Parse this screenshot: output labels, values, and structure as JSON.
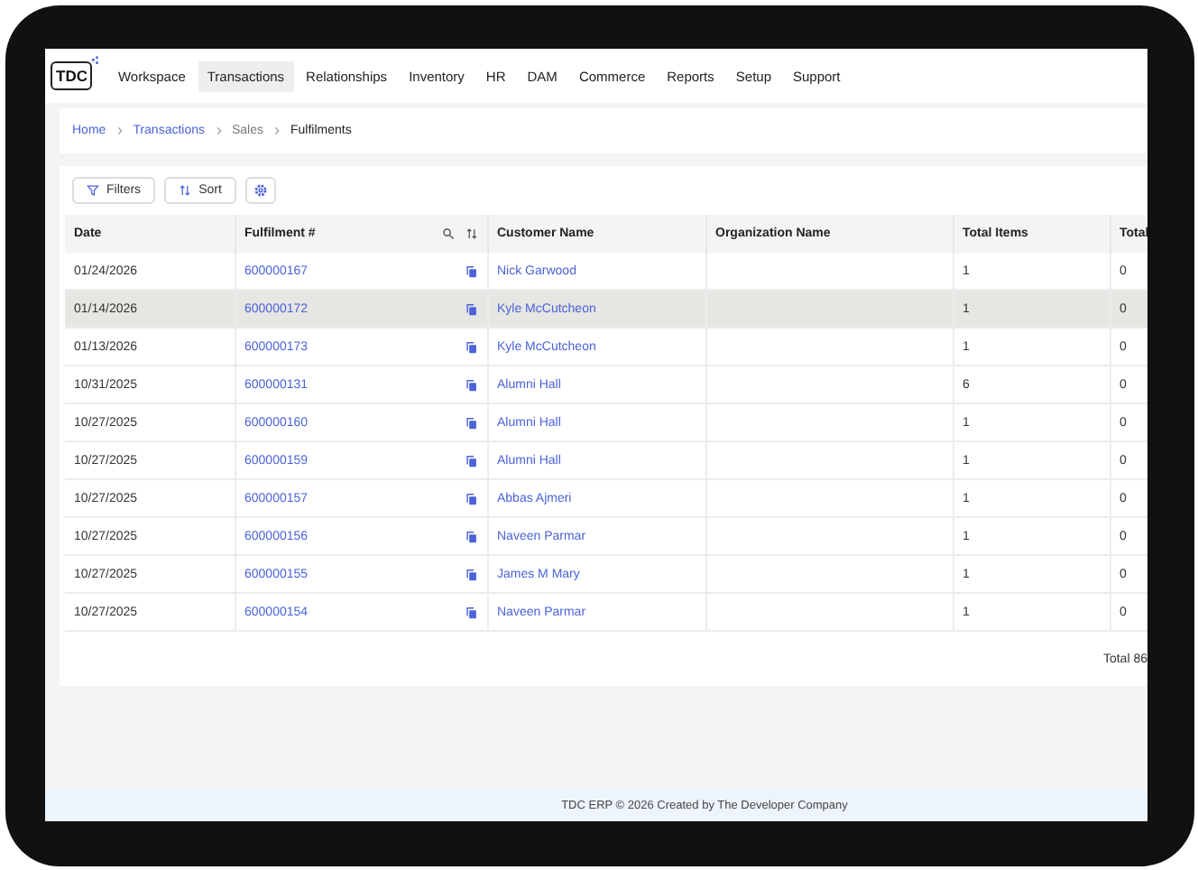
{
  "nav": {
    "logo": "TDC",
    "items": [
      {
        "label": "Workspace",
        "selected": false
      },
      {
        "label": "Transactions",
        "selected": true
      },
      {
        "label": "Relationships",
        "selected": false
      },
      {
        "label": "Inventory",
        "selected": false
      },
      {
        "label": "HR",
        "selected": false
      },
      {
        "label": "DAM",
        "selected": false
      },
      {
        "label": "Commerce",
        "selected": false
      },
      {
        "label": "Reports",
        "selected": false
      },
      {
        "label": "Setup",
        "selected": false
      },
      {
        "label": "Support",
        "selected": false
      }
    ]
  },
  "breadcrumb": [
    {
      "label": "Home",
      "kind": "link"
    },
    {
      "label": "Transactions",
      "kind": "link"
    },
    {
      "label": "Sales",
      "kind": "plain"
    },
    {
      "label": "Fulfilments",
      "kind": "current"
    }
  ],
  "toolbar": [
    {
      "kind": "filter",
      "label": "Filters"
    },
    {
      "kind": "sort",
      "label": "Sort"
    },
    {
      "kind": "settings"
    }
  ],
  "table": {
    "columns": [
      {
        "label": "Date",
        "searchable": false,
        "sortable": false
      },
      {
        "label": "Fulfilment #",
        "searchable": true,
        "sortable": true
      },
      {
        "label": "Customer Name",
        "searchable": false,
        "sortable": false
      },
      {
        "label": "Organization Name",
        "searchable": false,
        "sortable": false
      },
      {
        "label": "Total Items",
        "searchable": false,
        "sortable": false
      },
      {
        "label": "Total",
        "searchable": false,
        "sortable": false
      }
    ],
    "rows": [
      {
        "date": "01/24/2026",
        "fulfilment": "600000167",
        "customer": "Nick Garwood",
        "total_items": "1",
        "total": "0",
        "selected": false
      },
      {
        "date": "01/14/2026",
        "fulfilment": "600000172",
        "customer": "Kyle McCutcheon",
        "total_items": "1",
        "total": "0",
        "selected": true
      },
      {
        "date": "01/13/2026",
        "fulfilment": "600000173",
        "customer": "Kyle McCutcheon",
        "total_items": "1",
        "total": "0",
        "selected": false
      },
      {
        "date": "10/31/2025",
        "fulfilment": "600000131",
        "customer": "Alumni Hall",
        "total_items": "6",
        "total": "0",
        "selected": false
      },
      {
        "date": "10/27/2025",
        "fulfilment": "600000160",
        "customer": "Alumni Hall",
        "total_items": "1",
        "total": "0",
        "selected": false
      },
      {
        "date": "10/27/2025",
        "fulfilment": "600000159",
        "customer": "Alumni Hall",
        "total_items": "1",
        "total": "0",
        "selected": false
      },
      {
        "date": "10/27/2025",
        "fulfilment": "600000157",
        "customer": "Abbas Ajmeri",
        "total_items": "1",
        "total": "0",
        "selected": false
      },
      {
        "date": "10/27/2025",
        "fulfilment": "600000156",
        "customer": "Naveen Parmar",
        "total_items": "1",
        "total": "0",
        "selected": false
      },
      {
        "date": "10/27/2025",
        "fulfilment": "600000155",
        "customer": "James M Mary",
        "total_items": "1",
        "total": "0",
        "selected": false
      },
      {
        "date": "10/27/2025",
        "fulfilment": "600000154",
        "customer": "Naveen Parmar",
        "total_items": "1",
        "total": "0",
        "selected": false
      }
    ],
    "total": "Total 86"
  },
  "footer": "TDC ERP © 2026 Created by The Developer Company"
}
